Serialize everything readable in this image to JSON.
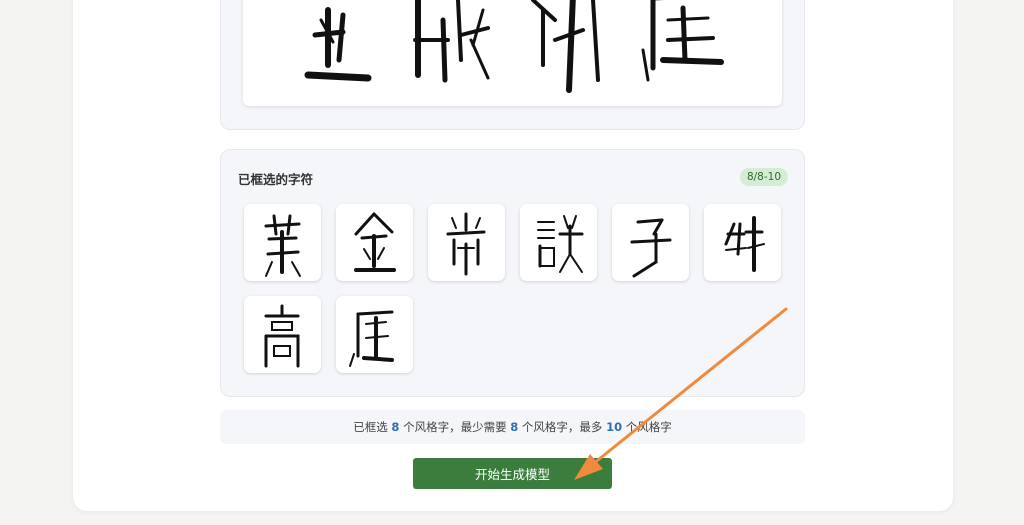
{
  "selected_panel": {
    "title": "已框选的字符",
    "badge": "8/8-10",
    "glyphs": [
      {
        "name": "glyph-1",
        "icon": "calligraphy-char-icon"
      },
      {
        "name": "glyph-2",
        "icon": "calligraphy-char-icon"
      },
      {
        "name": "glyph-3",
        "icon": "calligraphy-char-icon"
      },
      {
        "name": "glyph-4",
        "icon": "calligraphy-char-icon"
      },
      {
        "name": "glyph-5",
        "icon": "calligraphy-char-icon"
      },
      {
        "name": "glyph-6",
        "icon": "calligraphy-char-icon"
      },
      {
        "name": "glyph-7",
        "icon": "calligraphy-char-icon"
      },
      {
        "name": "glyph-8",
        "icon": "calligraphy-char-icon"
      }
    ]
  },
  "info": {
    "p1": "已框选 ",
    "n1": "8",
    "p2": " 个风格字，最少需要 ",
    "n2": "8",
    "p3": " 个风格字，最多 ",
    "n3": "10",
    "p4": " 个风格字"
  },
  "actions": {
    "generate_label": "开始生成模型"
  },
  "colors": {
    "accent_green": "#3a7d3c",
    "badge_bg": "#d5ecd5",
    "number_blue": "#2f6fb5",
    "arrow_orange": "#f08a3c"
  }
}
